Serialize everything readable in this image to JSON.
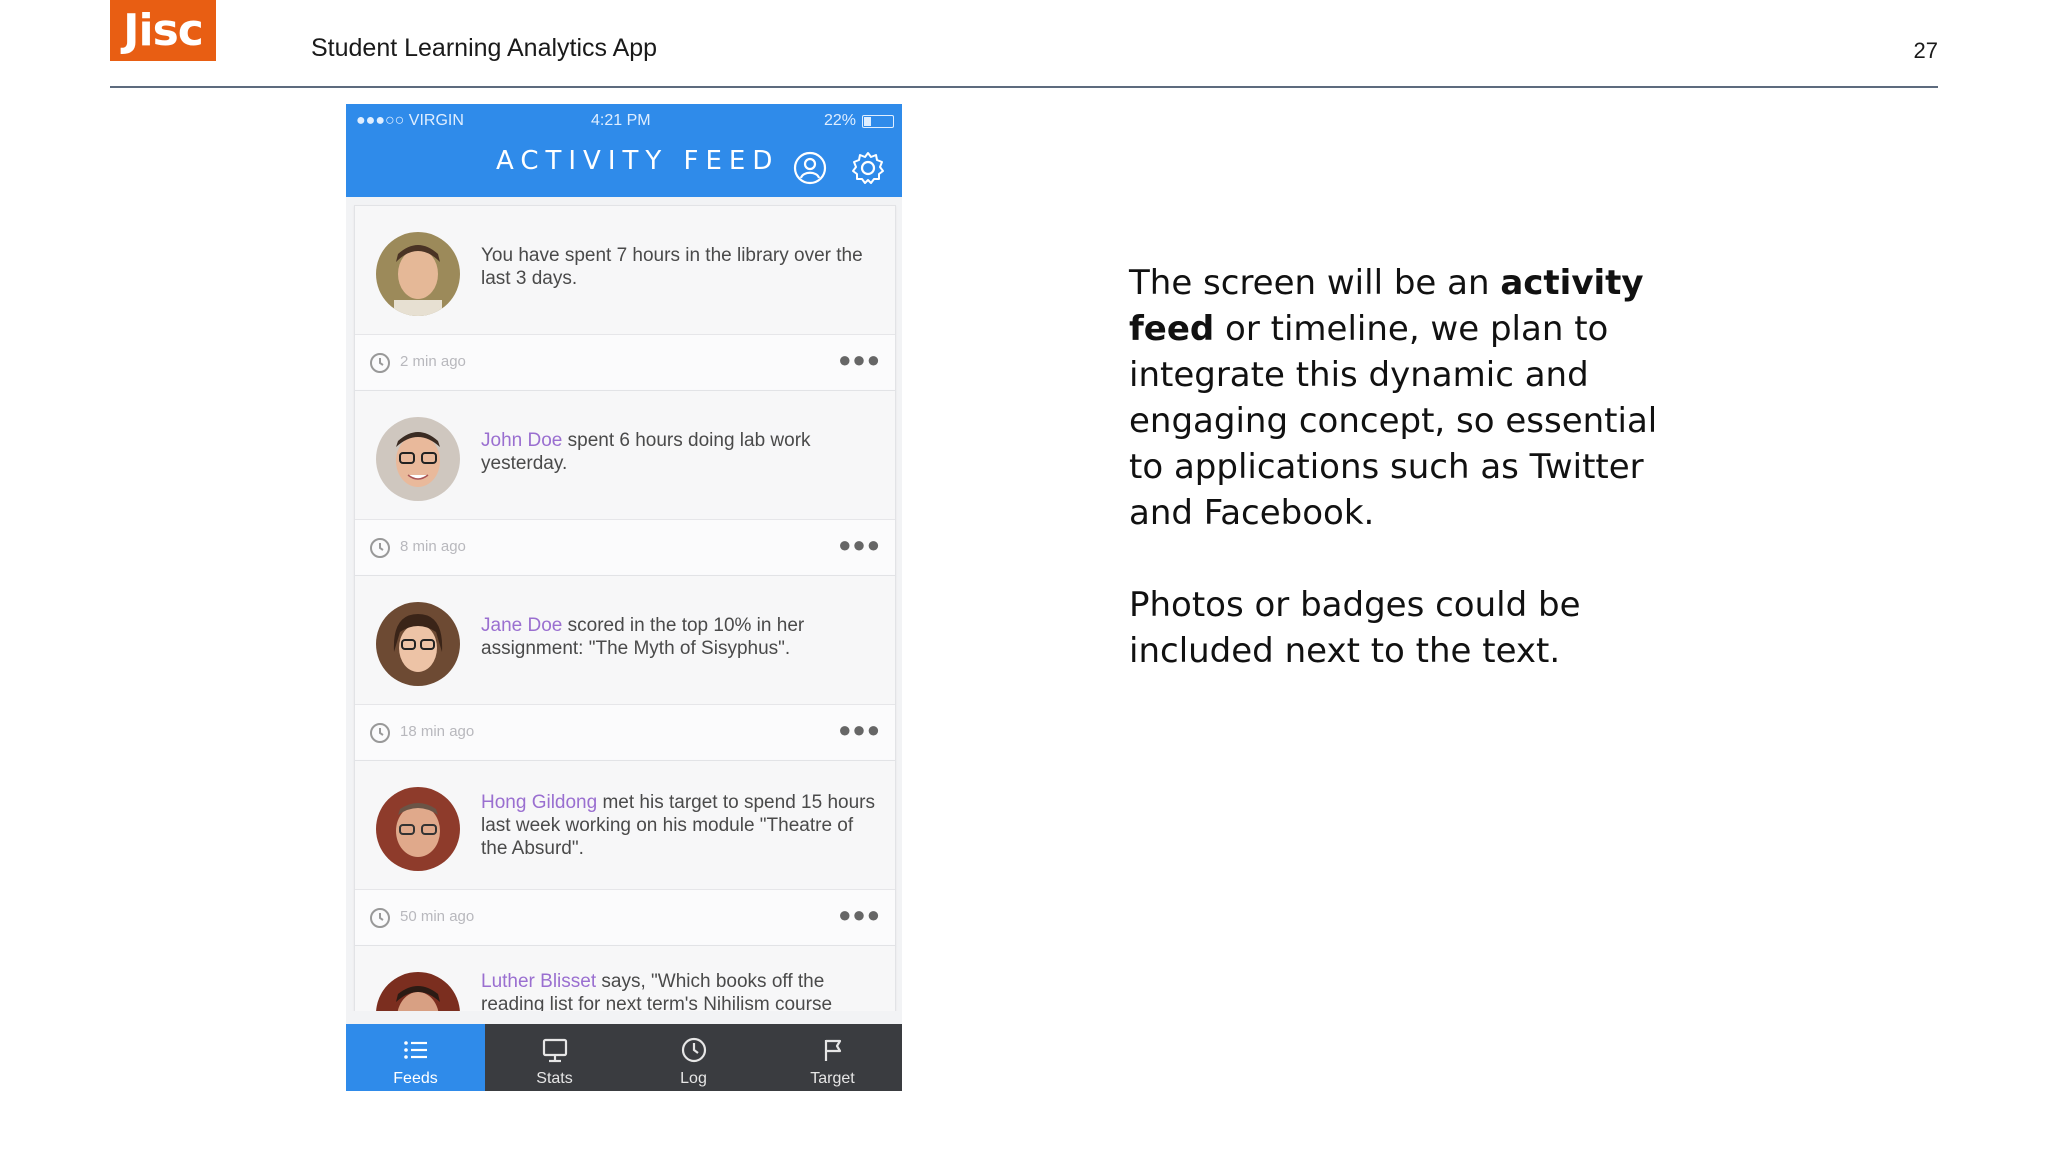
{
  "slide": {
    "logo_text": "Jisc",
    "title": "Student Learning Analytics App",
    "page_number": "27",
    "brand_color": "#e85e13"
  },
  "phone": {
    "status_bar": {
      "carrier": "●●●○○ VIRGIN",
      "time": "4:21 PM",
      "battery": "22%"
    },
    "screen_title": "ACTIVITY FEED",
    "header_icons": [
      "profile-icon",
      "gear-icon"
    ],
    "accent_color": "#2f8bea",
    "feed": [
      {
        "name": "",
        "text": "You have spent 7 hours in the library over the last 3 days.",
        "time": "2 min ago"
      },
      {
        "name": "John Doe",
        "text": " spent 6 hours doing lab work yesterday.",
        "time": "8 min ago"
      },
      {
        "name": "Jane Doe",
        "text": " scored in the top 10% in her assignment: \"The Myth of Sisyphus\".",
        "time": "18 min ago"
      },
      {
        "name": "Hong Gildong",
        "text": " met his target to spend 15 hours last week working on his module \"Theatre of the Absurd\".",
        "time": "50 min ago"
      },
      {
        "name": "Luther Blisset",
        "text": " says, \"Which books off the reading list for next term's Nihilism course",
        "time": ""
      }
    ],
    "tabs": [
      {
        "label": "Feeds",
        "icon": "list-icon"
      },
      {
        "label": "Stats",
        "icon": "monitor-icon"
      },
      {
        "label": "Log",
        "icon": "clock-icon"
      },
      {
        "label": "Target",
        "icon": "flag-icon"
      }
    ],
    "active_tab": "Feeds"
  },
  "description": {
    "p1_before": "The screen will be an ",
    "p1_bold": "activity feed",
    "p1_after": " or timeline, we plan to integrate this dynamic and engaging concept, so essential to applications such as Twitter and Facebook.",
    "p2": "Photos or badges could be included next to the text."
  }
}
